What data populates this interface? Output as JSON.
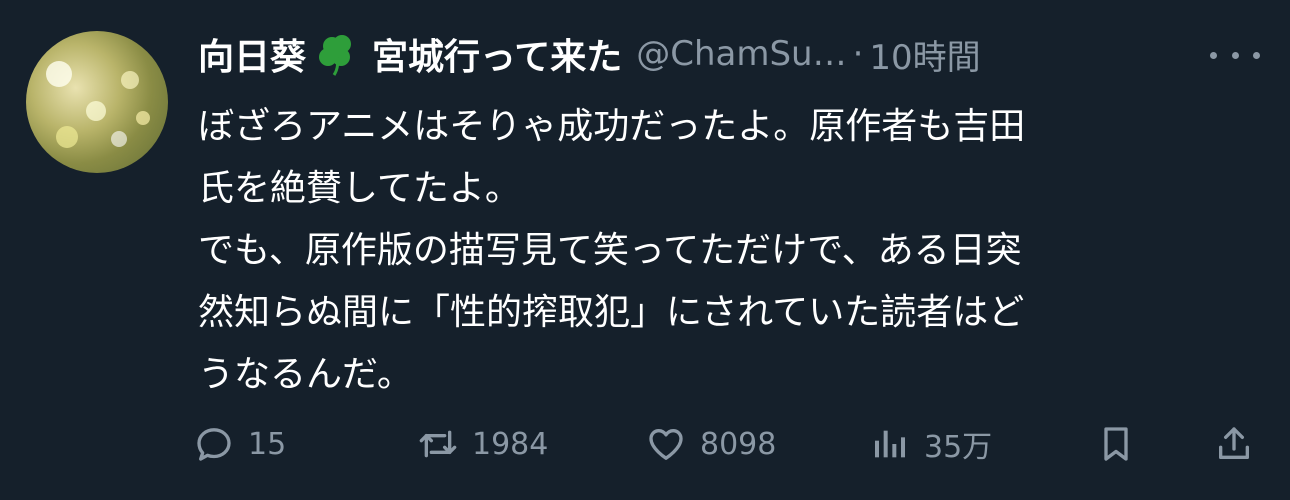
{
  "tweet": {
    "display_name": "向日葵",
    "display_name_suffix": "宮城行って来た",
    "name_emoji": "four-leaf-clover",
    "handle": "@ChamSu…",
    "separator": "·",
    "time": "10時間",
    "text_lines": [
      "ぼざろアニメはそりゃ成功だったよ。原作者も吉田",
      "氏を絶賛してたよ。",
      "でも、原作版の描写見て笑ってただけで、ある日突",
      "然知らぬ間に「性的搾取犯」にされていた読者はど",
      "うなるんだ。"
    ]
  },
  "actions": {
    "reply_count": "15",
    "retweet_count": "1984",
    "like_count": "8098",
    "views_count": "35万"
  },
  "icons": [
    "more-icon",
    "reply-icon",
    "retweet-icon",
    "like-icon",
    "views-icon",
    "bookmark-icon",
    "share-icon"
  ],
  "colors": {
    "background": "#15202b",
    "text": "#ffffff",
    "muted": "#8b98a5",
    "clover": "#2e9e3a"
  }
}
